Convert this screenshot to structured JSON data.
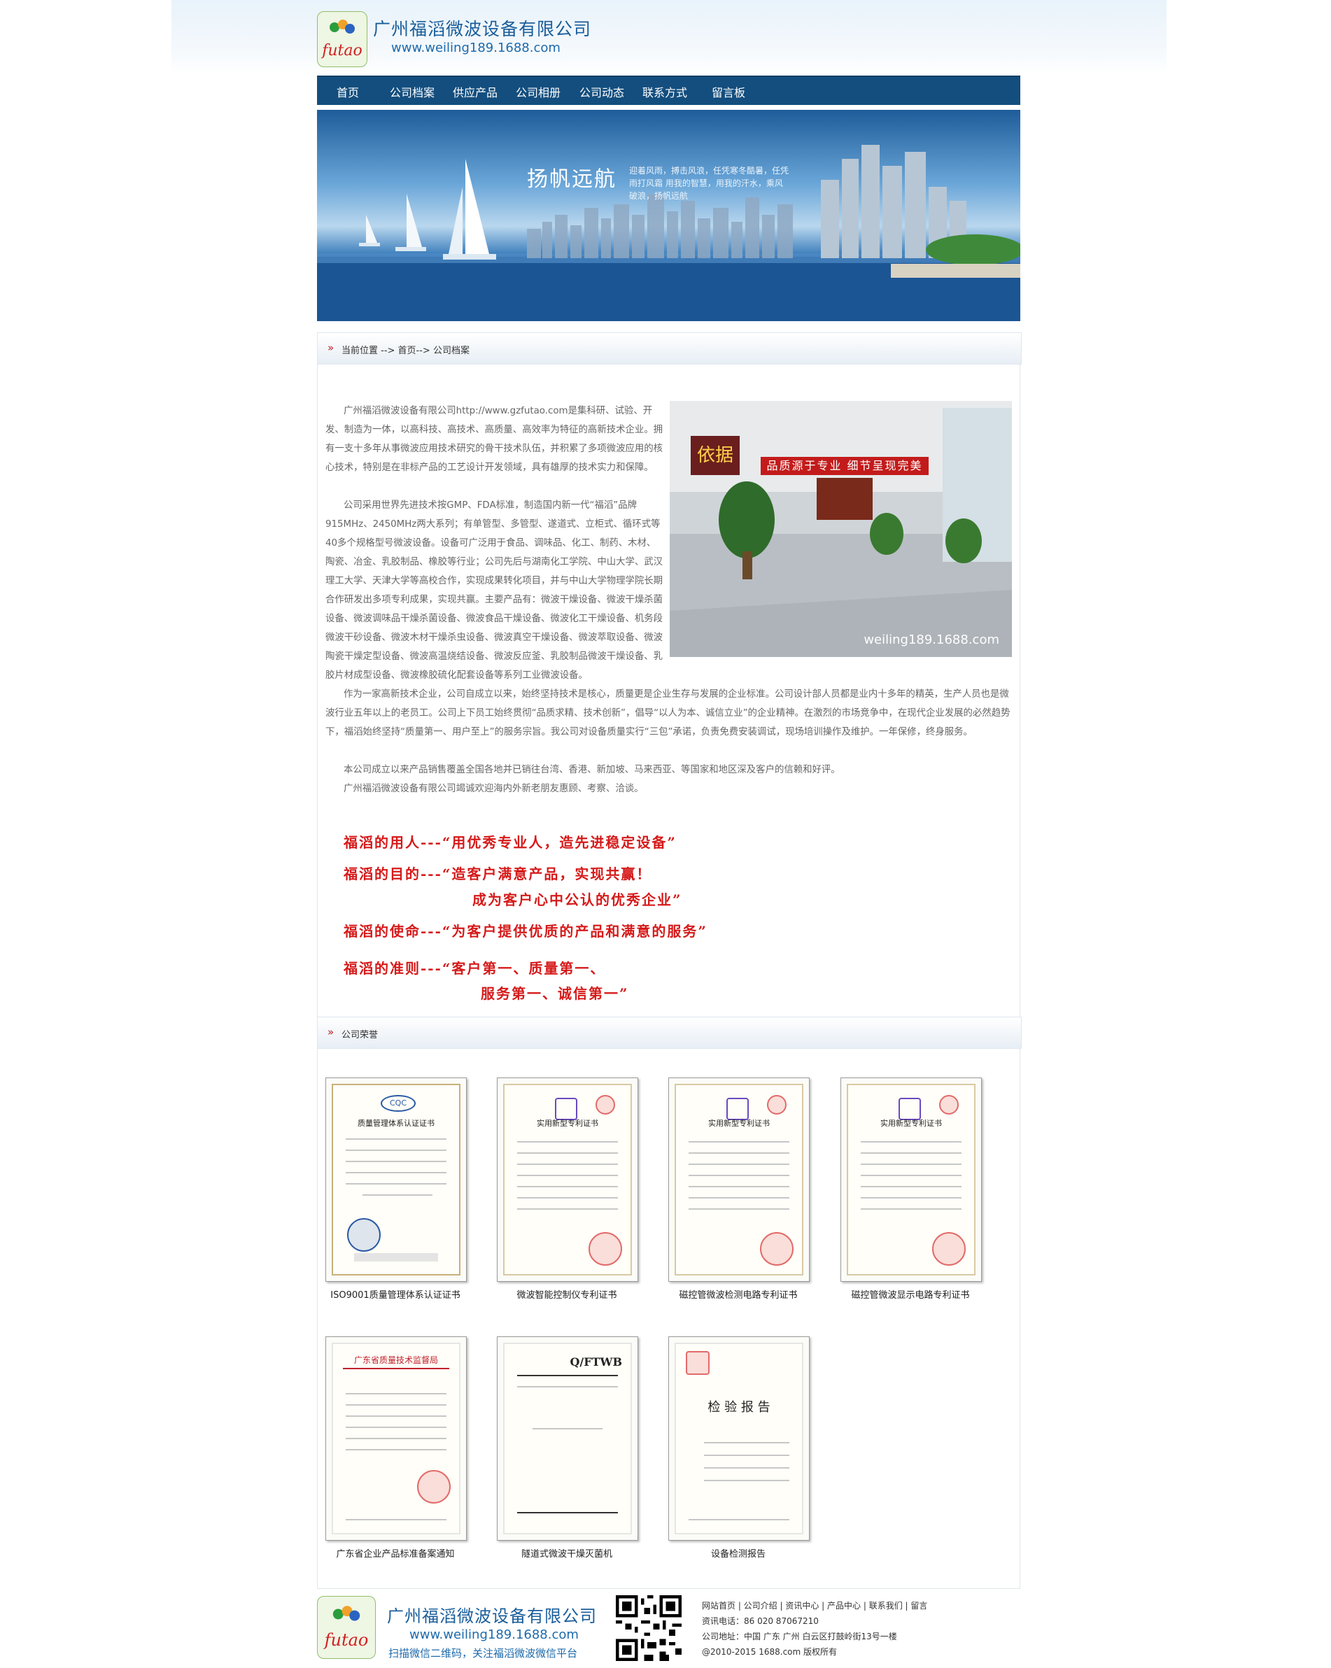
{
  "header": {
    "logo_text": "futao",
    "company_name": "广州福滔微波设备有限公司",
    "url": "www.weiling189.1688.com"
  },
  "nav": {
    "items": [
      "首页",
      "公司档案",
      "供应产品",
      "公司相册",
      "公司动态",
      "联系方式",
      "留言板"
    ]
  },
  "banner": {
    "title": "扬帆远航",
    "subtitle": "迎着风雨，搏击风浪，任凭寒冬酷暑，任凭雨打风霜 用我的智慧，用我的汗水，乘风破浪，扬帆远航"
  },
  "breadcrumb": {
    "arrow": "»",
    "text": "当前位置 --> 首页--> 公司档案"
  },
  "profile": {
    "p1": "广州福滔微波设备有限公司http://www.gzfutao.com是集科研、试验、开发、制造为一体，以高科技、高技术、高质量、高效率为特征的高新技术企业。拥有一支十多年从事微波应用技术研究的骨干技术队伍，并积累了多项微波应用的核心技术，特别是在非标产品的工艺设计开发领域，具有雄厚的技术实力和保障。",
    "p2": "公司采用世界先进技术按GMP、FDA标准，制造国内新一代“福滔”品牌915MHz、2450MHz两大系列；有单管型、多管型、遂道式、立柜式、循环式等40多个规格型号微波设备。设备可广泛用于食品、调味品、化工、制药、木材、陶瓷、冶金、乳胶制品、橡胶等行业；公司先后与湖南化工学院、中山大学、武汉理工大学、天津大学等高校合作，实现成果转化项目，并与中山大学物理学院长期合作研发出多项专利成果，实现共赢。主要产品有：微波干燥设备、微波干燥杀菌设备、微波调味品干燥杀菌设备、微波食品干燥设备、微波化工干燥设备、机务段微波干砂设备、微波木材干燥杀虫设备、微波真空干燥设备、微波萃取设备、微波陶瓷干燥定型设备、微波高温烧结设备、微波反应釜、乳胶制品微波干燥设备、乳胶片材成型设备、微波橡胶硫化配套设备等系列工业微波设备。",
    "p3": "作为一家高新技术企业，公司自成立以来，始终坚持技术是核心，质量更是企业生存与发展的企业标准。公司设计部人员都是业内十多年的精英，生产人员也是微波行业五年以上的老员工。公司上下员工始终贯彻“品质求精、技术创新”，倡导“以人为本、诚信立业”的企业精神。在激烈的市场竞争中，在现代企业发展的必然趋势下，福滔始终坚持“质量第一、用户至上”的服务宗旨。我公司对设备质量实行“三包”承诺，负责免费安装调试，现场培训操作及维护。一年保修，终身服务。",
    "p4": "本公司成立以来产品销售覆盖全国各地并已销往台湾、香港、新加坡、马来西亚、等国家和地区深及客户的信赖和好评。",
    "p5": "广州福滔微波设备有限公司竭诚欢迎海内外新老朋友惠顾、考察、洽谈。",
    "photo_banner": "品质源于专业  细节呈现完美",
    "photo_sign": "依据",
    "photo_watermark": "weiling189.1688.com"
  },
  "mottos": [
    "福滔的用人---“用优秀专业人，造先进稳定设备”",
    "福滔的目的---“造客户满意产品，实现共赢！",
    "成为客户心中公认的优秀企业”",
    "福滔的使命---“为客户提供优质的产品和满意的服务”",
    "福滔的准则---“客户第一、质量第一、",
    "服务第一、诚信第一”"
  ],
  "honors": {
    "title": "公司荣誉",
    "items": [
      {
        "caption": "ISO9001质量管理体系认证证书",
        "head": "质量管理体系认证证书"
      },
      {
        "caption": "微波智能控制仪专利证书",
        "head": "实用新型专利证书"
      },
      {
        "caption": "磁控管微波检测电路专利证书",
        "head": "实用新型专利证书"
      },
      {
        "caption": "磁控管微波显示电路专利证书",
        "head": "实用新型专利证书"
      },
      {
        "caption": "广东省企业产品标准备案通知",
        "head": "广东省质量技术监督局"
      },
      {
        "caption": "隧道式微波干燥灭菌机",
        "head": "Q/FTWB"
      },
      {
        "caption": "设备检测报告",
        "head": "检 验 报 告"
      }
    ]
  },
  "footer": {
    "logo_text": "futao",
    "company_name": "广州福滔微波设备有限公司",
    "url": "www.weiling189.1688.com",
    "scan_text": "扫描微信二维码，关注福滔微波微信平台",
    "links": "网站首页  |  公司介绍  |  资讯中心  |  产品中心  |  联系我们  |  留言",
    "phone": "资讯电话：86 020 87067210",
    "address": "公司地址：中国 广东 广州 白云区打鼓岭街13号一楼",
    "copyright": "@2010-2015 1688.com 版权所有"
  }
}
